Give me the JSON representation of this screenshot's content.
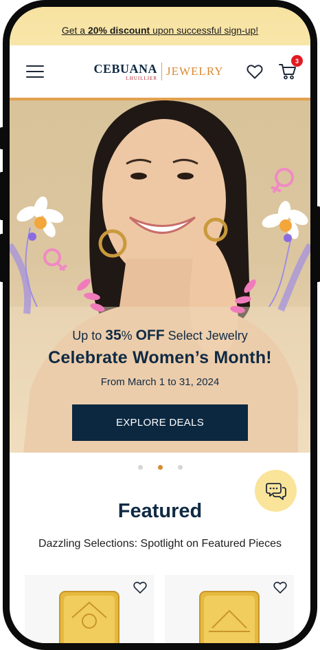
{
  "promo": {
    "prefix": "Get a ",
    "highlight": "20% discount",
    "suffix": " upon successful sign-up!"
  },
  "header": {
    "logo_main": "CEBUANA",
    "logo_sub": "LHUILLIER",
    "logo_right": "JEWELRY",
    "cart_count": "3",
    "icons": [
      "menu-icon",
      "heart-icon",
      "cart-icon"
    ]
  },
  "hero": {
    "line1_prefix": "Up to ",
    "line1_percent": "35",
    "line1_percent_sign": "% ",
    "line1_off": "OFF",
    "line1_suffix": " Select Jewelry",
    "title": "Celebrate Women’s Month!",
    "date": "From March 1 to 31, 2024",
    "cta": "EXPLORE DEALS"
  },
  "carousel": {
    "slides": 3,
    "active_index": 1
  },
  "featured": {
    "title": "Featured",
    "subtitle": "Dazzling Selections: Spotlight on Featured Pieces"
  },
  "colors": {
    "navy": "#0c2841",
    "gold": "#d98a31",
    "promo_bg": "#f7e2a0",
    "badge_red": "#e11b22",
    "chat_bg": "#f9e49a"
  }
}
